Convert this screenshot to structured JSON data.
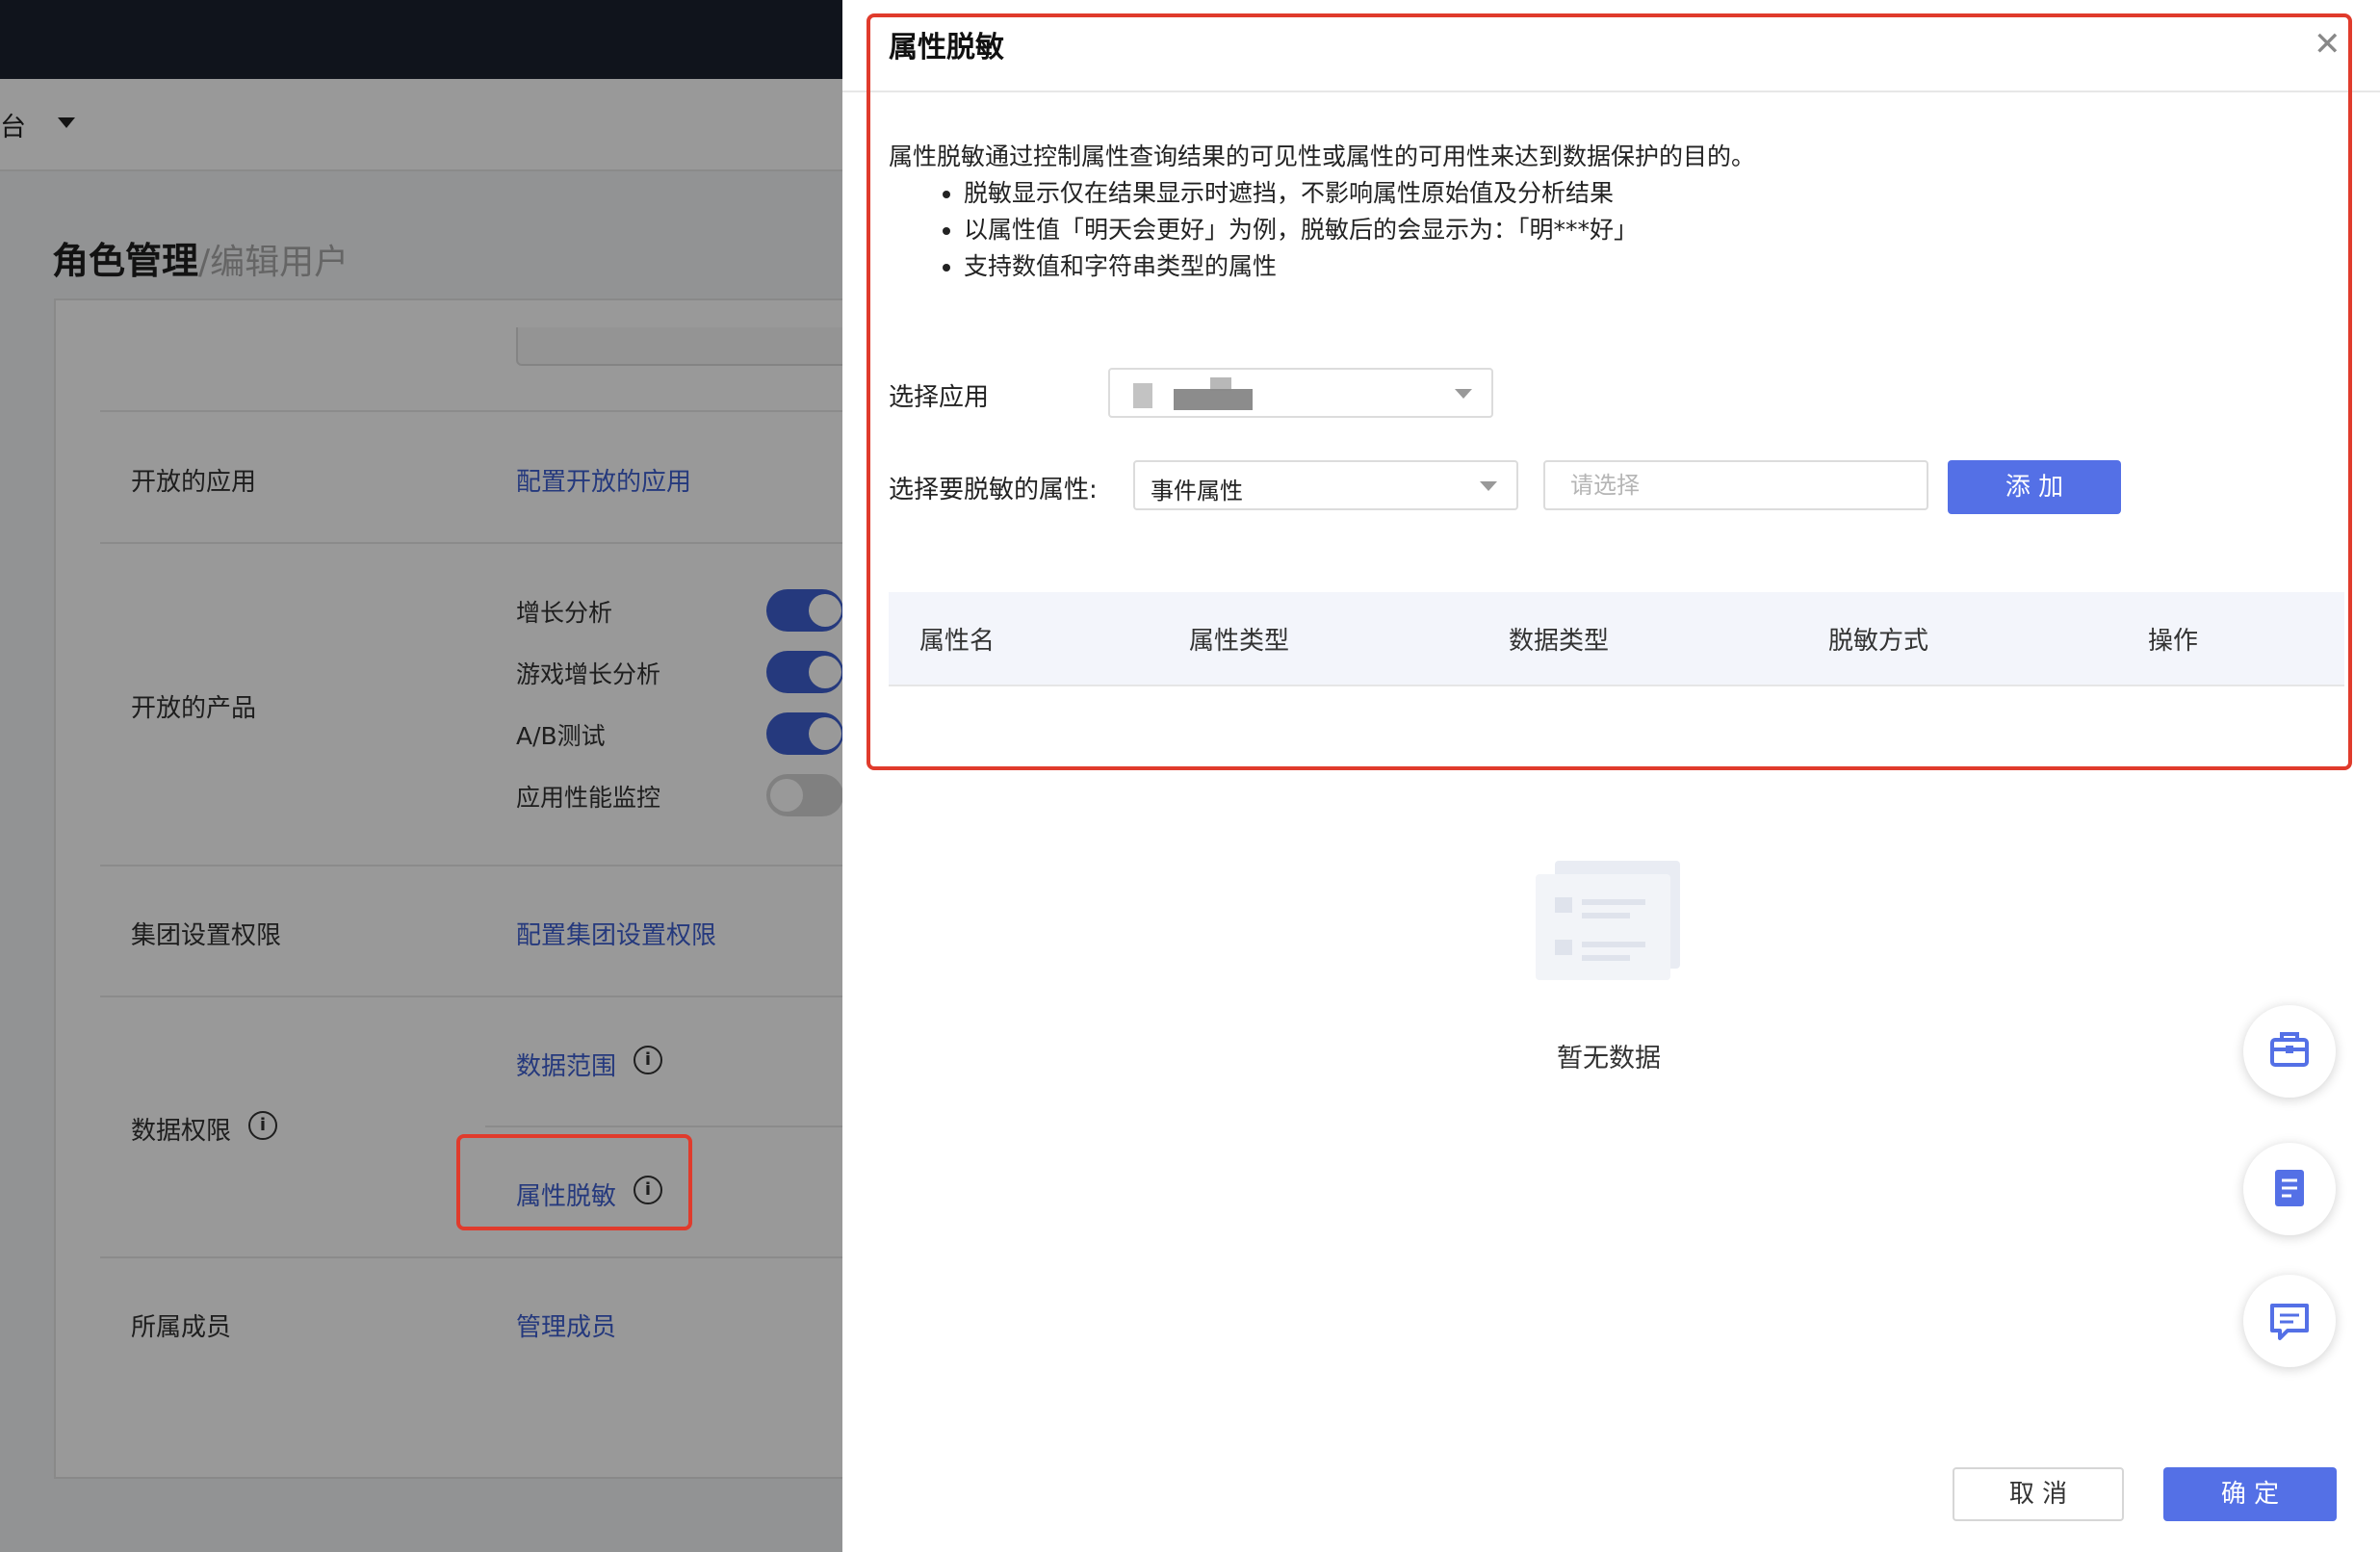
{
  "topbar": {
    "platform_fragment": "台"
  },
  "page": {
    "title": "角色管理",
    "subtitle": "/编辑用户"
  },
  "rows": {
    "open_apps": {
      "label": "开放的应用",
      "link": "配置开放的应用"
    },
    "open_products": {
      "label": "开放的产品",
      "items": [
        {
          "name": "增长分析",
          "enabled": true
        },
        {
          "name": "游戏增长分析",
          "enabled": true
        },
        {
          "name": "A/B测试",
          "enabled": true
        },
        {
          "name": "应用性能监控",
          "enabled": false
        }
      ]
    },
    "group_settings": {
      "label": "集团设置权限",
      "link": "配置集团设置权限"
    },
    "data_permission": {
      "label": "数据权限",
      "scope_link": "数据范围",
      "masking_link": "属性脱敏"
    },
    "members": {
      "label": "所属成员",
      "link": "管理成员"
    }
  },
  "drawer": {
    "title": "属性脱敏",
    "description": "属性脱敏通过控制属性查询结果的可见性或属性的可用性来达到数据保护的目的。",
    "bullets": [
      "脱敏显示仅在结果显示时遮挡，不影响属性原始值及分析结果",
      "以属性值「明天会更好」为例，脱敏后的会显示为：「明***好」",
      "支持数值和字符串类型的属性"
    ],
    "select_app_label": "选择应用",
    "select_attr_label": "选择要脱敏的属性:",
    "attr_type_value": "事件属性",
    "attr_placeholder": "请选择",
    "add_button": "添 加",
    "table_columns": [
      "属性名",
      "属性类型",
      "数据类型",
      "脱敏方式",
      "操作"
    ],
    "empty_text": "暂无数据",
    "cancel_button": "取 消",
    "confirm_button": "确 定"
  },
  "colors": {
    "accent": "#5470e6",
    "link": "#3e5fd0",
    "highlight": "#e03b2c"
  },
  "icons": {
    "float": [
      "toolbox-icon",
      "document-icon",
      "chat-icon"
    ]
  }
}
